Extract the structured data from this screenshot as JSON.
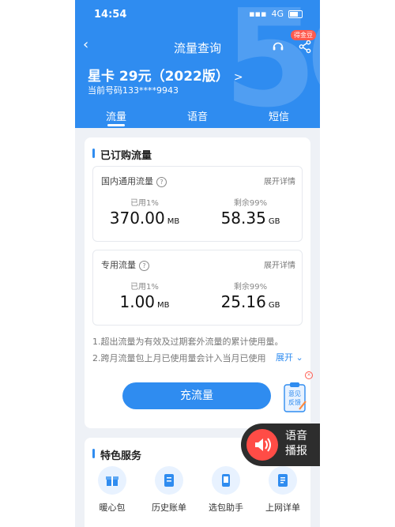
{
  "status": {
    "time": "14:54",
    "network": "4G"
  },
  "nav": {
    "title": "流量查询",
    "badge": "得金豆"
  },
  "plan": {
    "name": "星卡 29元（2022版）",
    "chev": ">",
    "number": "当前号码133****9943"
  },
  "tabs": [
    {
      "label": "流量"
    },
    {
      "label": "语音"
    },
    {
      "label": "短信"
    }
  ],
  "ordered": {
    "title": "已订购流量",
    "boxes": [
      {
        "name": "国内通用流量",
        "detail": "展开详情",
        "used_label": "已用1%",
        "remain_label": "剩余99%",
        "used_value": "370.00",
        "used_unit": "MB",
        "remain_value": "58.35",
        "remain_unit": "GB"
      },
      {
        "name": "专用流量",
        "detail": "展开详情",
        "used_label": "已用1%",
        "remain_label": "剩余99%",
        "used_value": "1.00",
        "used_unit": "MB",
        "remain_value": "25.16",
        "remain_unit": "GB"
      }
    ],
    "notes": [
      "1.超出流量为有效及过期套外流量的累计使用量。",
      "2.跨月流量包上月已使用量会计入当月已使用"
    ],
    "expand": "展开",
    "button": "充流量"
  },
  "feedback": {
    "label": "意见反馈"
  },
  "services": {
    "title": "特色服务",
    "items": [
      {
        "label": "暖心包"
      },
      {
        "label": "历史账单"
      },
      {
        "label": "选包助手"
      },
      {
        "label": "上网详单"
      }
    ]
  },
  "voice": {
    "line1": "语音",
    "line2": "播报"
  },
  "colors": {
    "brand": "#2f8cf0",
    "voice_bg": "#2d2d2d",
    "voice_icon": "#ff4c46"
  }
}
